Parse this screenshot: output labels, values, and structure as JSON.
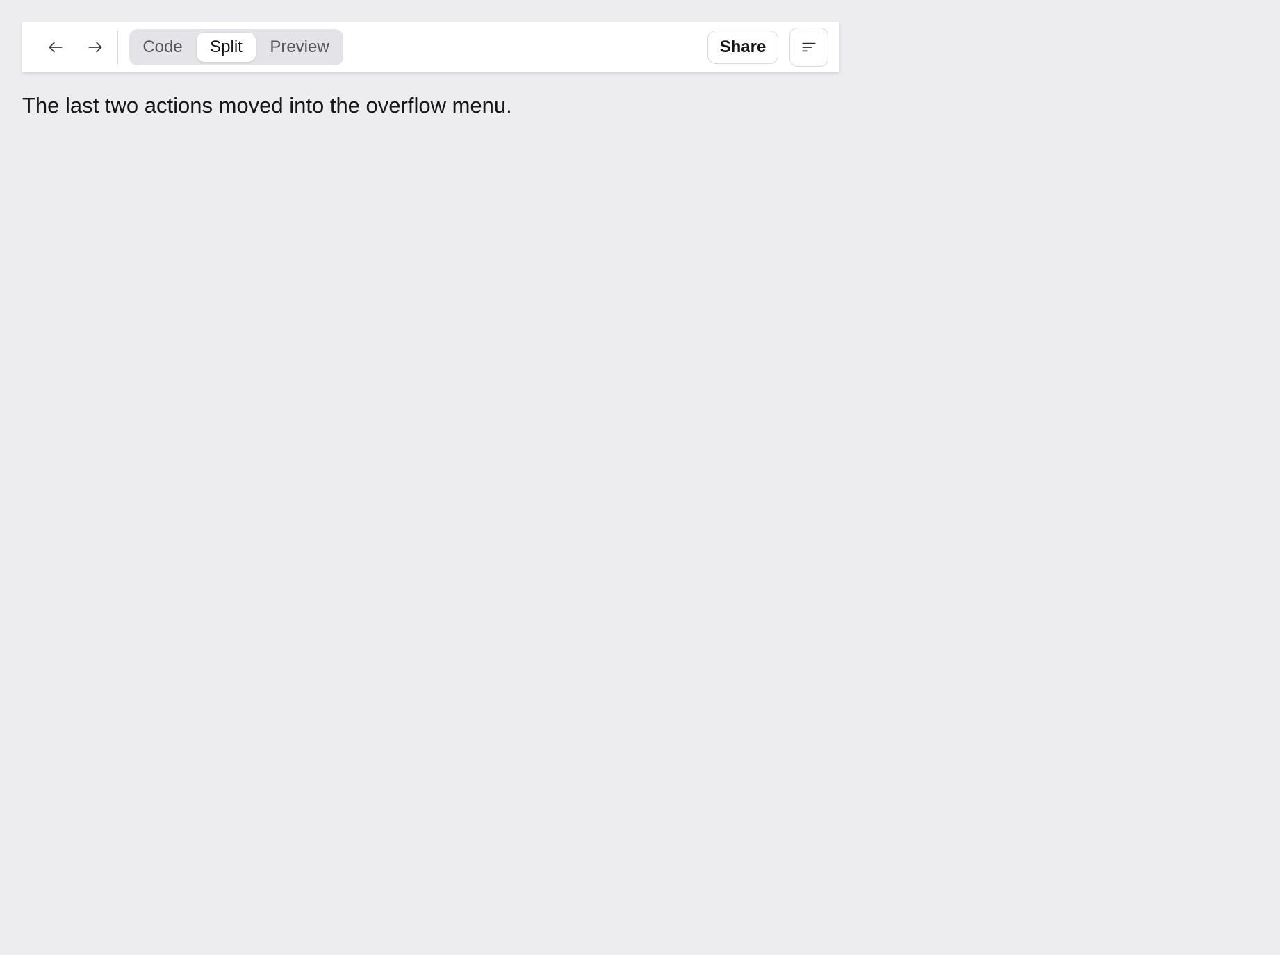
{
  "toolbar": {
    "nav": {
      "back_icon": "arrow-left-icon",
      "forward_icon": "arrow-right-icon"
    },
    "view_modes": [
      {
        "label": "Code",
        "selected": false
      },
      {
        "label": "Split",
        "selected": true
      },
      {
        "label": "Preview",
        "selected": false
      }
    ],
    "share_label": "Share",
    "overflow_icon": "menu-lines-icon"
  },
  "main": {
    "message": "The last two actions moved into the overflow menu."
  },
  "colors": {
    "page_background": "#ededf0",
    "toolbar_background": "#ffffff",
    "segmented_background": "#e4e4e8",
    "border": "#d9d9de",
    "text": "#16161a"
  }
}
